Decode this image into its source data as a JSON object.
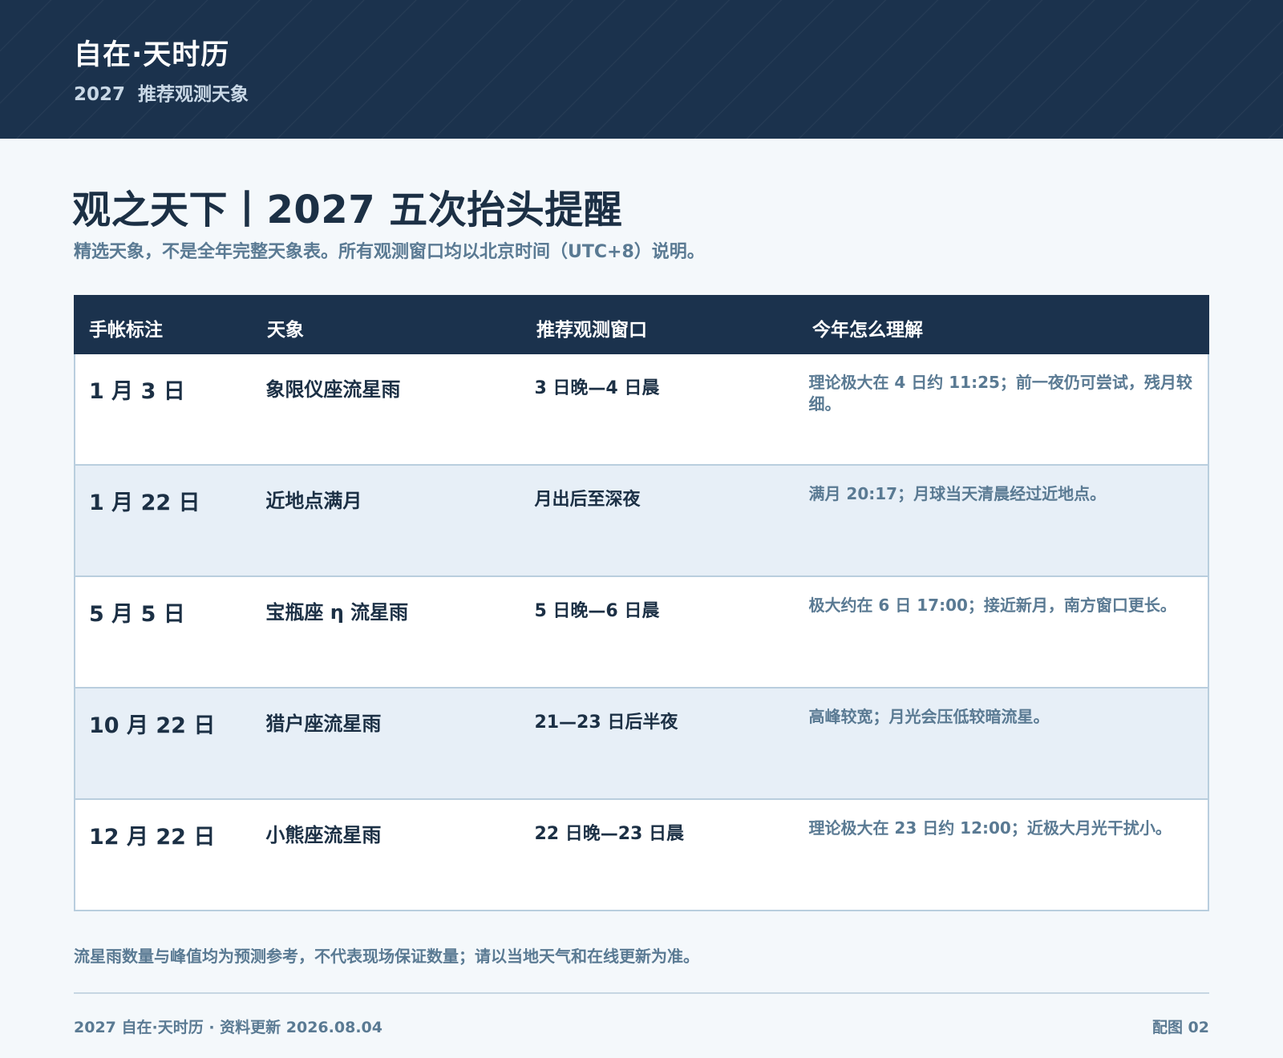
{
  "header": {
    "brand": "自在·天时历",
    "subtitle": "2027  推荐观测天象"
  },
  "main": {
    "title": "观之天下丨2027 五次抬头提醒",
    "description": "精选天象，不是全年完整天象表。所有观测窗口均以北京时间（UTC+8）说明。"
  },
  "table": {
    "headers": [
      "手帐标注",
      "天象",
      "推荐观测窗口",
      "今年怎么理解"
    ],
    "rows": [
      {
        "date": "1 月 3 日",
        "event": "象限仪座流星雨",
        "window": "3 日晚—4 日晨",
        "note": "理论极大在 4 日约 11:25；前一夜仍可尝试，残月较细。"
      },
      {
        "date": "1 月 22 日",
        "event": "近地点满月",
        "window": "月出后至深夜",
        "note": "满月 20:17；月球当天清晨经过近地点。"
      },
      {
        "date": "5 月 5 日",
        "event": "宝瓶座 η 流星雨",
        "window": "5 日晚—6 日晨",
        "note": "极大约在 6 日 17:00；接近新月，南方窗口更长。"
      },
      {
        "date": "10 月 22 日",
        "event": "猎户座流星雨",
        "window": "21—23 日后半夜",
        "note": "高峰较宽；月光会压低较暗流星。"
      },
      {
        "date": "12 月 22 日",
        "event": "小熊座流星雨",
        "window": "22 日晚—23 日晨",
        "note": "理论极大在 23 日约 12:00；近极大月光干扰小。"
      }
    ]
  },
  "disclaimer": "流星雨数量与峰值均为预测参考，不代表现场保证数量；请以当地天气和在线更新为准。",
  "footer": {
    "left": "2027 自在·天时历 · 资料更新 2026.08.04",
    "right": "配图 02"
  },
  "colors": {
    "header_bg": "#1b324d",
    "page_bg": "#f4f8fb",
    "alt_row_bg": "#e7eff7",
    "text_dark": "#1c3045",
    "text_muted": "#5a7a93",
    "border": "#b9cede"
  }
}
